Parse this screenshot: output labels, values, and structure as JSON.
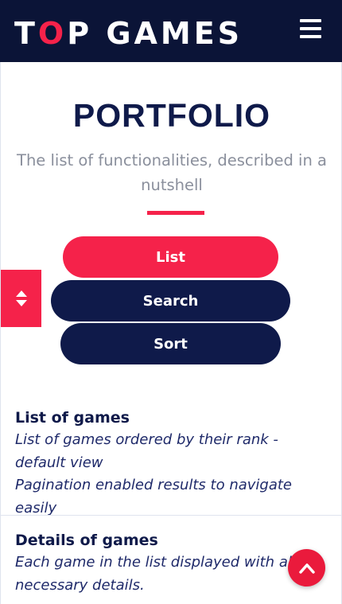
{
  "brand": {
    "logo_before": "T",
    "logo_accent": "O",
    "logo_after": "P GAMES"
  },
  "nav": {
    "menu_icon": "hamburger-menu-icon"
  },
  "hero": {
    "title": "PORTFOLIO",
    "subtitle": "The list of functionalities, described in a nutshell"
  },
  "filters": {
    "list_label": "List",
    "search_label": "Search",
    "sort_label": "Sort"
  },
  "side_toggle": {
    "icon": "up-down-arrows-icon"
  },
  "features": [
    {
      "title": "List of games",
      "lines": [
        "List of games ordered by their rank - default view",
        "Pagination enabled results to navigate easily"
      ]
    },
    {
      "title": "Details of games",
      "lines": [
        "Each game in the list displayed with all the necessary details."
      ]
    }
  ],
  "scroll_top": {
    "icon": "chevron-up-icon"
  },
  "colors": {
    "navy": "#0f1a4a",
    "accent": "#f5224a",
    "header_bg": "#0b1437"
  }
}
